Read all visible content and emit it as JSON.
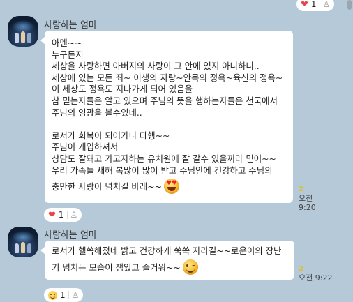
{
  "top_reaction": {
    "count": "1"
  },
  "messages": [
    {
      "sender": "사랑하는 엄마",
      "lines": [
        "아멘~~",
        "누구든지",
        "세상을 사랑하면 아버지의 사랑이 그 안에 있지 아니하니..",
        "세상에 있는 모든 죄~ 이생의 자랑~안목의 정욕~육신의 정욕~",
        "이 세상도 정욕도 지나가게 되어 있음을",
        "참 믿는자들은 알고 있으며  주님의 뜻을 행하는자들은 천국에서",
        "주님의 영광을 볼수있네..",
        "",
        "로서가 회복이 되어가니 다행~~",
        "주님이 개입하셔서",
        "상담도 잘돼고 가고자하는 유치원에 잘 갈수  있을꺼라 믿어~~",
        "우리 가족들 새해 복많이 많이 받고 주님안에 건강하고 주님의",
        "충만한 사랑이 넘치길 바래~~"
      ],
      "end_emoji": "heart-eyes",
      "unread": "2",
      "time": "오전 9:20",
      "reaction_count": "1"
    },
    {
      "sender": "사랑하는 엄마",
      "lines": [
        "로서가 헬쓱해졌네 밝고 건강하게 쑥쑥 자라길~~로운이의 장난",
        "기 넘치는 모습이 잼있고  즐거워~~"
      ],
      "end_emoji": "wink",
      "unread": "2",
      "time": "오전 9:22",
      "reaction_count": "1"
    }
  ]
}
